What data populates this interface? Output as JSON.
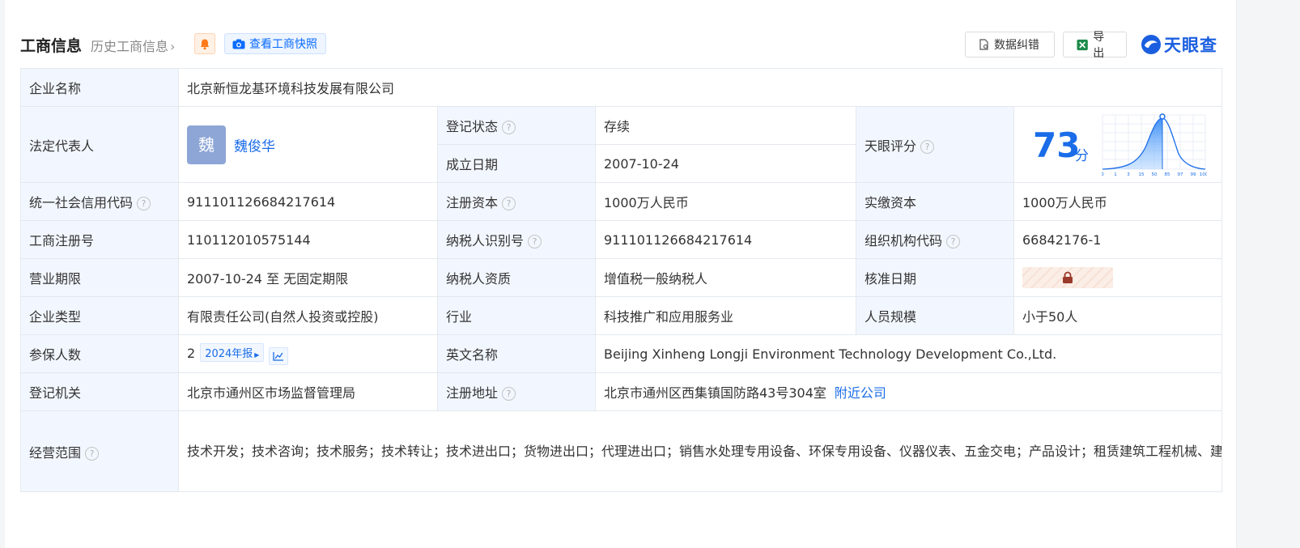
{
  "header": {
    "title": "工商信息",
    "history_link": "历史工商信息",
    "snapshot_button": "查看工商快照",
    "correct_button": "数据纠错",
    "export_button": "导出",
    "logo_text": "天眼查",
    "icons": [
      "bell-icon",
      "camera-icon",
      "document-icon",
      "excel-icon",
      "logo-icon"
    ]
  },
  "company": {
    "name_label": "企业名称",
    "name": "北京新恒龙基环境科技发展有限公司",
    "legal_rep_label": "法定代表人",
    "legal_rep_avatar": "魏",
    "legal_rep": "魏俊华",
    "reg_status_label": "登记状态",
    "reg_status": "存续",
    "est_date_label": "成立日期",
    "est_date": "2007-10-24",
    "score_label": "天眼评分",
    "score": "73",
    "score_unit": "分",
    "score_axis": [
      "0",
      "1",
      "3",
      "15",
      "50",
      "85",
      "97",
      "99",
      "100"
    ],
    "credit_code_label": "统一社会信用代码",
    "credit_code": "911101126684217614",
    "reg_capital_label": "注册资本",
    "reg_capital": "1000万人民币",
    "paid_capital_label": "实缴资本",
    "paid_capital": "1000万人民币",
    "reg_no_label": "工商注册号",
    "reg_no": "110112010575144",
    "taxpayer_id_label": "纳税人识别号",
    "taxpayer_id": "911101126684217614",
    "org_code_label": "组织机构代码",
    "org_code": "66842176-1",
    "term_label": "营业期限",
    "term": "2007-10-24 至 无固定期限",
    "taxpayer_qual_label": "纳税人资质",
    "taxpayer_qual": "增值税一般纳税人",
    "approve_date_label": "核准日期",
    "type_label": "企业类型",
    "type": "有限责任公司(自然人投资或控股)",
    "industry_label": "行业",
    "industry": "科技推广和应用服务业",
    "staff_label": "人员规模",
    "staff": "小于50人",
    "insured_label": "参保人数",
    "insured": "2",
    "report_tag": "2024年报",
    "en_name_label": "英文名称",
    "en_name": "Beijing Xinheng Longji Environment Technology Development Co.,Ltd.",
    "authority_label": "登记机关",
    "authority": "北京市通州区市场监督管理局",
    "address_label": "注册地址",
    "address": "北京市通州区西集镇国防路43号304室",
    "nearby_link": "附近公司",
    "scope_label": "经营范围",
    "scope": "技术开发；技术咨询；技术服务；技术转让；技术进出口；货物进出口；代理进出口；销售水处理专用设备、环保专用设备、仪器仪表、五金交电；产品设计；租赁建筑工程机械、建筑工程设备；专业承包；工程勘察设计。（企业依法自主选择经营项目，开展经营活动；依法须经批准的项目，经相关部门批准后依批准的内容开展经营活动；不得从事本区产业政策禁止和限制类项目的经营活动。）"
  },
  "colors": {
    "accent": "#1a6ce8",
    "status_green": "#18a058",
    "label_bg": "#f2f7ff",
    "border": "#e4e8ee"
  }
}
